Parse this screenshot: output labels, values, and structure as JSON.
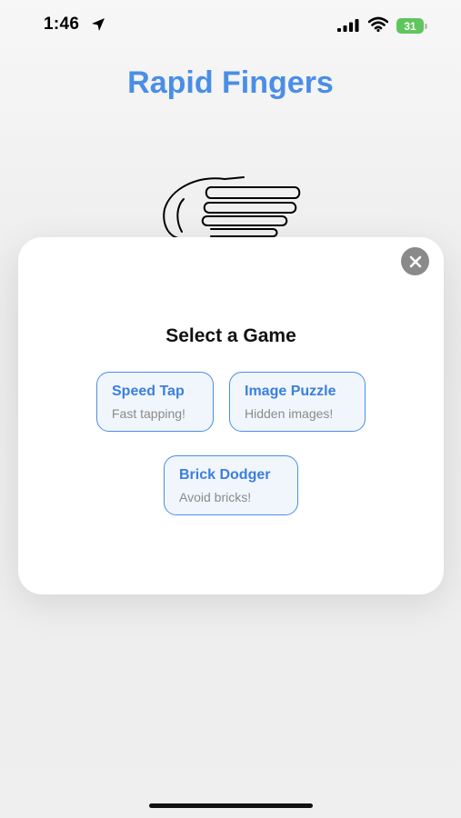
{
  "status_bar": {
    "time": "1:46",
    "battery_level": "31",
    "icons": [
      "location-arrow-icon",
      "cellular-signal-icon",
      "wifi-icon",
      "battery-charging-icon"
    ]
  },
  "app": {
    "title": "Rapid Fingers",
    "illustration": "tapping-hand-icon",
    "accent_color": "#4a8ee6"
  },
  "modal": {
    "title": "Select a Game",
    "close_icon": "close-icon",
    "games": [
      {
        "name": "Speed Tap",
        "description": "Fast tapping!"
      },
      {
        "name": "Image Puzzle",
        "description": "Hidden images!"
      },
      {
        "name": "Brick Dodger",
        "description": "Avoid bricks!"
      }
    ]
  }
}
